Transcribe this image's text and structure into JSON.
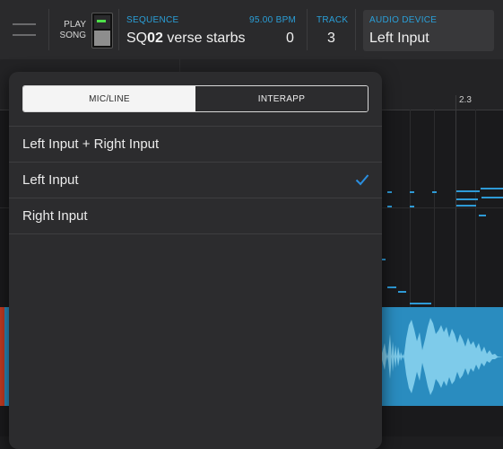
{
  "header": {
    "menu_icon": "hamburger-icon",
    "play_song_line1": "PLAY",
    "play_song_line2": "SONG",
    "sequence_label": "SEQUENCE",
    "bpm_label": "95.00 BPM",
    "sequence_prefix": "SQ",
    "sequence_number": "02",
    "sequence_name": " verse starbs",
    "bpm_value": "0",
    "track_label": "TRACK",
    "track_value": "3",
    "audio_device_label": "AUDIO DEVICE",
    "audio_device_value": "Left Input"
  },
  "timeline": {
    "ruler_marker": "2.3"
  },
  "popover": {
    "tabs": [
      {
        "label": "MIC/LINE",
        "active": true
      },
      {
        "label": "INTERAPP",
        "active": false
      }
    ],
    "options": [
      {
        "label": "Left Input + Right Input",
        "selected": false
      },
      {
        "label": "Left Input",
        "selected": true,
        "check_icon": "checkmark-icon"
      },
      {
        "label": "Right Input",
        "selected": false
      }
    ]
  },
  "colors": {
    "accent": "#2a9fd8",
    "toggle_led": "#4ee04a",
    "audio_region": "#2a8cbf",
    "marker_red": "#c23b22"
  }
}
